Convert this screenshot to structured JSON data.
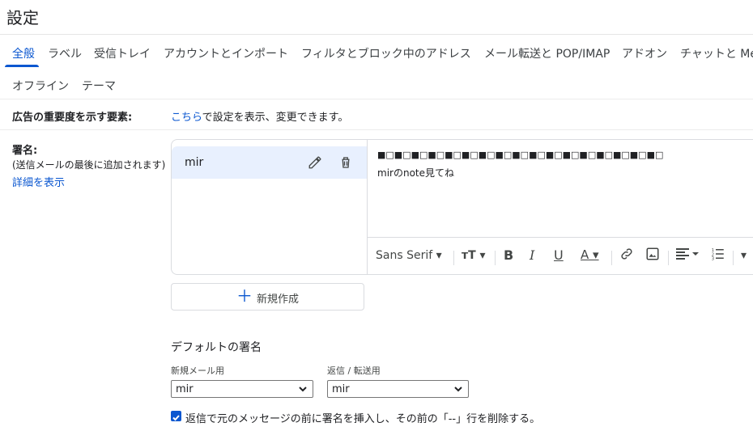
{
  "page_title": "設定",
  "tabs": [
    "全般",
    "ラベル",
    "受信トレイ",
    "アカウントとインポート",
    "フィルタとブロック中のアドレス",
    "メール転送と POP/IMAP",
    "アドオン",
    "チャットと Me"
  ],
  "tabs_row2": [
    "オフライン",
    "テーマ"
  ],
  "ads_setting": {
    "label": "広告の重要度を示す要素:",
    "link": "こちら",
    "text": "で設定を表示、変更できます。"
  },
  "signature": {
    "label": "署名:",
    "note": "(送信メールの最後に追加されます)",
    "details_link": "詳細を表示",
    "items": [
      {
        "name": "mir"
      }
    ],
    "editor_line1": "■□■□■□■□■□■□■□■□■□■□■□■□■□■□■□■□■□",
    "editor_line2": "mirのnote見てね",
    "toolbar": {
      "font": "Sans Serif",
      "icons": [
        "font-size-icon",
        "bold-icon",
        "italic-icon",
        "underline-icon",
        "text-color-icon",
        "link-icon",
        "image-icon",
        "align-icon",
        "list-icon",
        "more-icon"
      ]
    },
    "new_button": "新規作成"
  },
  "defaults": {
    "title": "デフォルトの署名",
    "new_mail_label": "新規メール用",
    "new_mail_value": "mir",
    "reply_label": "返信 / 転送用",
    "reply_value": "mir",
    "checkbox_checked": true,
    "checkbox_label": "返信で元のメッセージの前に署名を挿入し、その前の「--」行を削除する。"
  },
  "colors": {
    "accent": "#0b57d0",
    "selected_bg": "#e8f0fe"
  }
}
